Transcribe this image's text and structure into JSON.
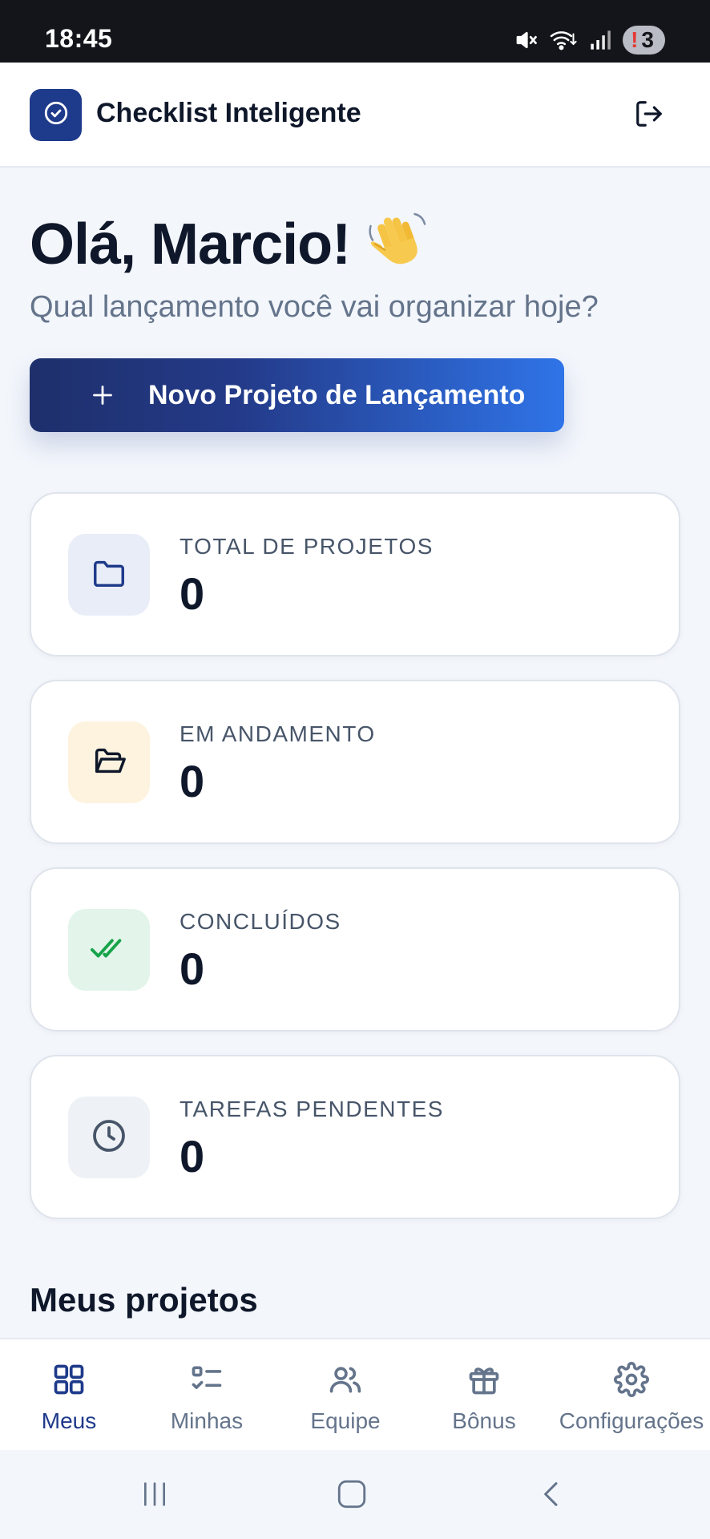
{
  "status_bar": {
    "time": "18:45",
    "notification_count": "3",
    "icons": [
      "mute-icon",
      "wifi-icon",
      "signal-icon",
      "alert-icon"
    ]
  },
  "header": {
    "title": "Checklist Inteligente",
    "logo_icon": "check-circle-icon",
    "logout_icon": "logout-icon"
  },
  "greeting": {
    "title": "Olá, Marcio!",
    "emoji": "👋",
    "subtitle": "Qual lançamento você vai organizar hoje?"
  },
  "new_project_button": {
    "label": "Novo Projeto de Lançamento",
    "icon": "plus-icon"
  },
  "stats": [
    {
      "label": "TOTAL DE PROJETOS",
      "value": "0",
      "icon": "folder-icon",
      "bg": "#e8edf7",
      "color": "#1e3a8a"
    },
    {
      "label": "EM ANDAMENTO",
      "value": "0",
      "icon": "folder-open-icon",
      "bg": "#fdf3df",
      "color": "#0f172a"
    },
    {
      "label": "CONCLUÍDOS",
      "value": "0",
      "icon": "double-check-icon",
      "bg": "#e3f5ea",
      "color": "#16a34a"
    },
    {
      "label": "TAREFAS PENDENTES",
      "value": "0",
      "icon": "clock-icon",
      "bg": "#eef2f6",
      "color": "#475569"
    }
  ],
  "section": {
    "title": "Meus projetos"
  },
  "bottom_nav": [
    {
      "label": "Meus",
      "icon": "grid-icon",
      "active": true
    },
    {
      "label": "Minhas",
      "icon": "checklist-icon",
      "active": false
    },
    {
      "label": "Equipe",
      "icon": "users-icon",
      "active": false
    },
    {
      "label": "Bônus",
      "icon": "gift-icon",
      "active": false
    },
    {
      "label": "Configurações",
      "icon": "settings-icon",
      "active": false
    }
  ],
  "colors": {
    "primary": "#1e3a8a",
    "accent": "#2f74e8",
    "background": "#f3f6fb"
  }
}
